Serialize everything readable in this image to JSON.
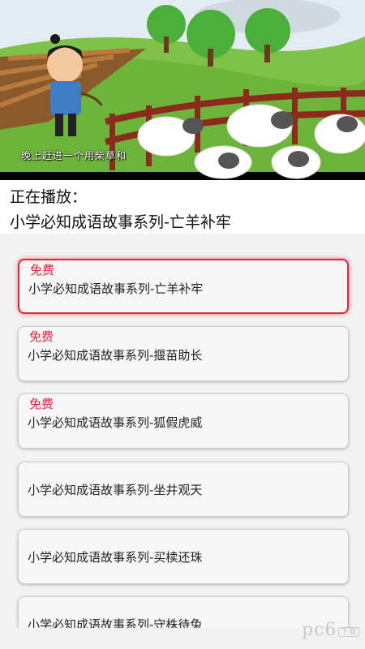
{
  "video": {
    "subtitle": "晚上赶进一个用柴草和"
  },
  "now_playing": {
    "label": "正在播放：",
    "title": "小学必知成语故事系列-亡羊补牢"
  },
  "playlist": [
    {
      "badge": "免费",
      "title": "小学必知成语故事系列-亡羊补牢",
      "active": true
    },
    {
      "badge": "免费",
      "title": "小学必知成语故事系列-揠苗助长",
      "active": false
    },
    {
      "badge": "免费",
      "title": "小学必知成语故事系列-狐假虎威",
      "active": false
    },
    {
      "badge": "",
      "title": "小学必知成语故事系列-坐井观天",
      "active": false
    },
    {
      "badge": "",
      "title": "小学必知成语故事系列-买椟还珠",
      "active": false
    },
    {
      "badge": "",
      "title": "小学必知成语故事系列-守株待兔",
      "active": false
    }
  ],
  "watermark": {
    "text": "pc6",
    "badge": "下载"
  },
  "colors": {
    "accent": "#e0243c",
    "list_bg": "#f2f2f2"
  }
}
